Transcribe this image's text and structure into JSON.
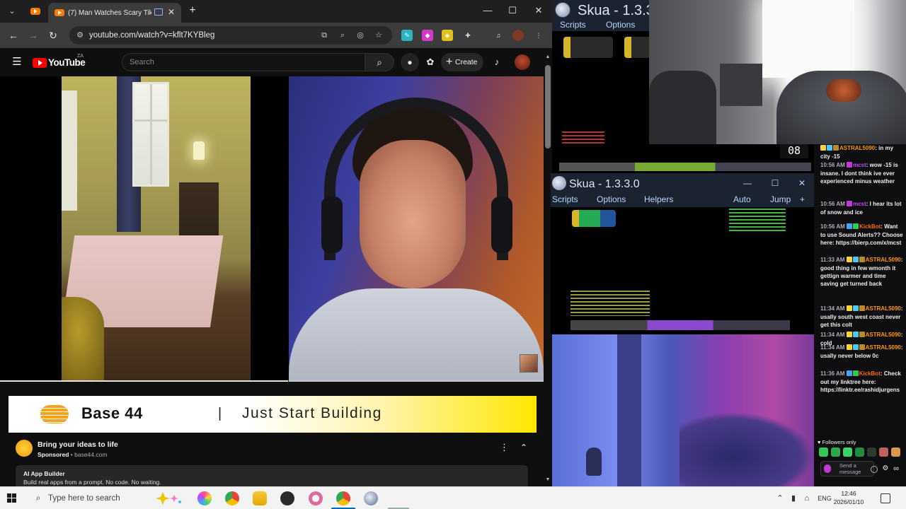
{
  "browser": {
    "tab_title": "(7) Man Watches Scary TikT",
    "url": "youtube.com/watch?v=kflt7KYBleg",
    "new_tab": "+",
    "minimize": "—",
    "maximize": "☐",
    "close": "✕",
    "tab_menu": "⌄",
    "tab_close": "✕",
    "back": "←",
    "forward": "→",
    "reload": "↻"
  },
  "youtube": {
    "logo": "YouTube",
    "country": "ZA",
    "search_placeholder": "Search",
    "create_label": "Create",
    "notification_count": "",
    "progress": 0.53
  },
  "ad": {
    "brand": "Base 44",
    "separator": "|",
    "tagline": "Just Start Building",
    "title": "Bring your ideas to life",
    "sponsored": "Sponsored",
    "domain": "base44.com",
    "card_title": "AI App Builder",
    "card_desc": "Build real apps from a prompt. No code. No waiting."
  },
  "skua_top": {
    "title": "Skua - 1.3.3.",
    "menu": [
      "Scripts",
      "Options"
    ]
  },
  "game": {
    "score": "08"
  },
  "skua_window": {
    "title": "Skua - 1.3.3.0",
    "menu": [
      "Scripts",
      "Options",
      "Helpers"
    ],
    "right_menu": [
      "Auto",
      "Jump",
      "+"
    ],
    "min": "—",
    "max": "☐",
    "close": "✕"
  },
  "chat": {
    "messages": [
      {
        "time": "",
        "user": "ASTRAL5090",
        "color": "#ff9800",
        "text": "in my city -15",
        "badges": [
          "#ffd23a",
          "#4ac8ff",
          "#b98b2a"
        ]
      },
      {
        "time": "10:56 AM",
        "user": "mcst",
        "color": "#c04bff",
        "text": "wow -15 is insane. I dont think ive ever experienced minus weather",
        "badges": [
          "#c03bd6"
        ]
      },
      {
        "time": "10:56 AM",
        "user": "mcst",
        "color": "#c04bff",
        "text": "I hear its lot of snow and ice",
        "badges": [
          "#c03bd6"
        ]
      },
      {
        "time": "10:56 AM",
        "user": "KickBot",
        "color": "#ff6a00",
        "text": "Want to use Sound Alerts?? Choose here: https://bierp.com/x/mcst",
        "badges": [
          "#4aa0ff",
          "#35c759"
        ]
      },
      {
        "time": "11:33 AM",
        "user": "ASTRAL5090",
        "color": "#ff9800",
        "text": "good thing in few wmonth it gettign warmer and time saving get turned back",
        "badges": [
          "#ffd23a",
          "#4ac8ff",
          "#b98b2a"
        ]
      },
      {
        "time": "11:34 AM",
        "user": "ASTRAL5090",
        "color": "#ff9800",
        "text": "usally south west coast never get this colt",
        "badges": [
          "#ffd23a",
          "#4ac8ff",
          "#b98b2a"
        ]
      },
      {
        "time": "11:34 AM",
        "user": "ASTRAL5090",
        "color": "#ff9800",
        "text": "cold",
        "badges": [
          "#ffd23a",
          "#4ac8ff",
          "#b98b2a"
        ]
      },
      {
        "time": "11:34 AM",
        "user": "ASTRAL5090",
        "color": "#ff9800",
        "text": "usally never below 0c",
        "badges": [
          "#ffd23a",
          "#4ac8ff",
          "#b98b2a"
        ]
      },
      {
        "time": "11:36 AM",
        "user": "KickBot",
        "color": "#ff6a00",
        "text": "Check out my linktree here: https://linktr.ee/rashidjurgens",
        "badges": [
          "#4aa0ff",
          "#35c759"
        ]
      }
    ],
    "followers_only": "♥ Followers only",
    "input_placeholder": "Send a message"
  },
  "taskbar": {
    "search_placeholder": "Type here to search",
    "language": "ENG",
    "time": "12:46",
    "date": "2026/01/10"
  }
}
